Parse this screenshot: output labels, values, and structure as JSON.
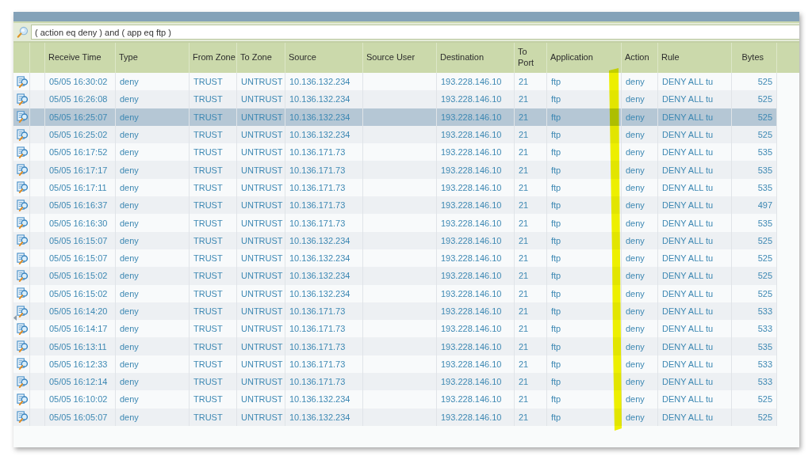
{
  "filter_bar": {
    "query": "( action eq deny ) and ( app eq ftp )"
  },
  "table": {
    "columns": [
      "Receive Time",
      "Type",
      "From Zone",
      "To Zone",
      "Source",
      "Source User",
      "Destination",
      "To Port",
      "Application",
      "Action",
      "Rule",
      "Bytes"
    ],
    "rows": [
      {
        "receive_time": "05/05 16:30:02",
        "type": "deny",
        "from_zone": "TRUST",
        "to_zone": "UNTRUST",
        "source": "10.136.132.234",
        "destination": "193.228.146.10",
        "to_port": "21",
        "application": "ftp",
        "action": "deny",
        "rule": "DENY ALL tu",
        "bytes": "525",
        "selected": false
      },
      {
        "receive_time": "05/05 16:26:08",
        "type": "deny",
        "from_zone": "TRUST",
        "to_zone": "UNTRUST",
        "source": "10.136.132.234",
        "destination": "193.228.146.10",
        "to_port": "21",
        "application": "ftp",
        "action": "deny",
        "rule": "DENY ALL tu",
        "bytes": "525",
        "selected": false
      },
      {
        "receive_time": "05/05 16:25:07",
        "type": "deny",
        "from_zone": "TRUST",
        "to_zone": "UNTRUST",
        "source": "10.136.132.234",
        "destination": "193.228.146.10",
        "to_port": "21",
        "application": "ftp",
        "action": "deny",
        "rule": "DENY ALL tu",
        "bytes": "525",
        "selected": true
      },
      {
        "receive_time": "05/05 16:25:02",
        "type": "deny",
        "from_zone": "TRUST",
        "to_zone": "UNTRUST",
        "source": "10.136.132.234",
        "destination": "193.228.146.10",
        "to_port": "21",
        "application": "ftp",
        "action": "deny",
        "rule": "DENY ALL tu",
        "bytes": "525",
        "selected": false
      },
      {
        "receive_time": "05/05 16:17:52",
        "type": "deny",
        "from_zone": "TRUST",
        "to_zone": "UNTRUST",
        "source": "10.136.171.73",
        "destination": "193.228.146.10",
        "to_port": "21",
        "application": "ftp",
        "action": "deny",
        "rule": "DENY ALL tu",
        "bytes": "535",
        "selected": false
      },
      {
        "receive_time": "05/05 16:17:17",
        "type": "deny",
        "from_zone": "TRUST",
        "to_zone": "UNTRUST",
        "source": "10.136.171.73",
        "destination": "193.228.146.10",
        "to_port": "21",
        "application": "ftp",
        "action": "deny",
        "rule": "DENY ALL tu",
        "bytes": "535",
        "selected": false
      },
      {
        "receive_time": "05/05 16:17:11",
        "type": "deny",
        "from_zone": "TRUST",
        "to_zone": "UNTRUST",
        "source": "10.136.171.73",
        "destination": "193.228.146.10",
        "to_port": "21",
        "application": "ftp",
        "action": "deny",
        "rule": "DENY ALL tu",
        "bytes": "535",
        "selected": false
      },
      {
        "receive_time": "05/05 16:16:37",
        "type": "deny",
        "from_zone": "TRUST",
        "to_zone": "UNTRUST",
        "source": "10.136.171.73",
        "destination": "193.228.146.10",
        "to_port": "21",
        "application": "ftp",
        "action": "deny",
        "rule": "DENY ALL tu",
        "bytes": "497",
        "selected": false
      },
      {
        "receive_time": "05/05 16:16:30",
        "type": "deny",
        "from_zone": "TRUST",
        "to_zone": "UNTRUST",
        "source": "10.136.171.73",
        "destination": "193.228.146.10",
        "to_port": "21",
        "application": "ftp",
        "action": "deny",
        "rule": "DENY ALL tu",
        "bytes": "535",
        "selected": false
      },
      {
        "receive_time": "05/05 16:15:07",
        "type": "deny",
        "from_zone": "TRUST",
        "to_zone": "UNTRUST",
        "source": "10.136.132.234",
        "destination": "193.228.146.10",
        "to_port": "21",
        "application": "ftp",
        "action": "deny",
        "rule": "DENY ALL tu",
        "bytes": "525",
        "selected": false
      },
      {
        "receive_time": "05/05 16:15:07",
        "type": "deny",
        "from_zone": "TRUST",
        "to_zone": "UNTRUST",
        "source": "10.136.132.234",
        "destination": "193.228.146.10",
        "to_port": "21",
        "application": "ftp",
        "action": "deny",
        "rule": "DENY ALL tu",
        "bytes": "525",
        "selected": false
      },
      {
        "receive_time": "05/05 16:15:02",
        "type": "deny",
        "from_zone": "TRUST",
        "to_zone": "UNTRUST",
        "source": "10.136.132.234",
        "destination": "193.228.146.10",
        "to_port": "21",
        "application": "ftp",
        "action": "deny",
        "rule": "DENY ALL tu",
        "bytes": "525",
        "selected": false
      },
      {
        "receive_time": "05/05 16:15:02",
        "type": "deny",
        "from_zone": "TRUST",
        "to_zone": "UNTRUST",
        "source": "10.136.132.234",
        "destination": "193.228.146.10",
        "to_port": "21",
        "application": "ftp",
        "action": "deny",
        "rule": "DENY ALL tu",
        "bytes": "525",
        "selected": false
      },
      {
        "receive_time": "05/05 16:14:20",
        "type": "deny",
        "from_zone": "TRUST",
        "to_zone": "UNTRUST",
        "source": "10.136.171.73",
        "destination": "193.228.146.10",
        "to_port": "21",
        "application": "ftp",
        "action": "deny",
        "rule": "DENY ALL tu",
        "bytes": "533",
        "selected": false
      },
      {
        "receive_time": "05/05 16:14:17",
        "type": "deny",
        "from_zone": "TRUST",
        "to_zone": "UNTRUST",
        "source": "10.136.171.73",
        "destination": "193.228.146.10",
        "to_port": "21",
        "application": "ftp",
        "action": "deny",
        "rule": "DENY ALL tu",
        "bytes": "533",
        "selected": false
      },
      {
        "receive_time": "05/05 16:13:11",
        "type": "deny",
        "from_zone": "TRUST",
        "to_zone": "UNTRUST",
        "source": "10.136.171.73",
        "destination": "193.228.146.10",
        "to_port": "21",
        "application": "ftp",
        "action": "deny",
        "rule": "DENY ALL tu",
        "bytes": "535",
        "selected": false
      },
      {
        "receive_time": "05/05 16:12:33",
        "type": "deny",
        "from_zone": "TRUST",
        "to_zone": "UNTRUST",
        "source": "10.136.171.73",
        "destination": "193.228.146.10",
        "to_port": "21",
        "application": "ftp",
        "action": "deny",
        "rule": "DENY ALL tu",
        "bytes": "533",
        "selected": false
      },
      {
        "receive_time": "05/05 16:12:14",
        "type": "deny",
        "from_zone": "TRUST",
        "to_zone": "UNTRUST",
        "source": "10.136.171.73",
        "destination": "193.228.146.10",
        "to_port": "21",
        "application": "ftp",
        "action": "deny",
        "rule": "DENY ALL tu",
        "bytes": "533",
        "selected": false
      },
      {
        "receive_time": "05/05 16:10:02",
        "type": "deny",
        "from_zone": "TRUST",
        "to_zone": "UNTRUST",
        "source": "10.136.132.234",
        "destination": "193.228.146.10",
        "to_port": "21",
        "application": "ftp",
        "action": "deny",
        "rule": "DENY ALL tu",
        "bytes": "525",
        "selected": false
      },
      {
        "receive_time": "05/05 16:05:07",
        "type": "deny",
        "from_zone": "TRUST",
        "to_zone": "UNTRUST",
        "source": "10.136.132.234",
        "destination": "193.228.146.10",
        "to_port": "21",
        "application": "ftp",
        "action": "deny",
        "rule": "DENY ALL tu",
        "bytes": "525",
        "selected": false
      }
    ]
  }
}
